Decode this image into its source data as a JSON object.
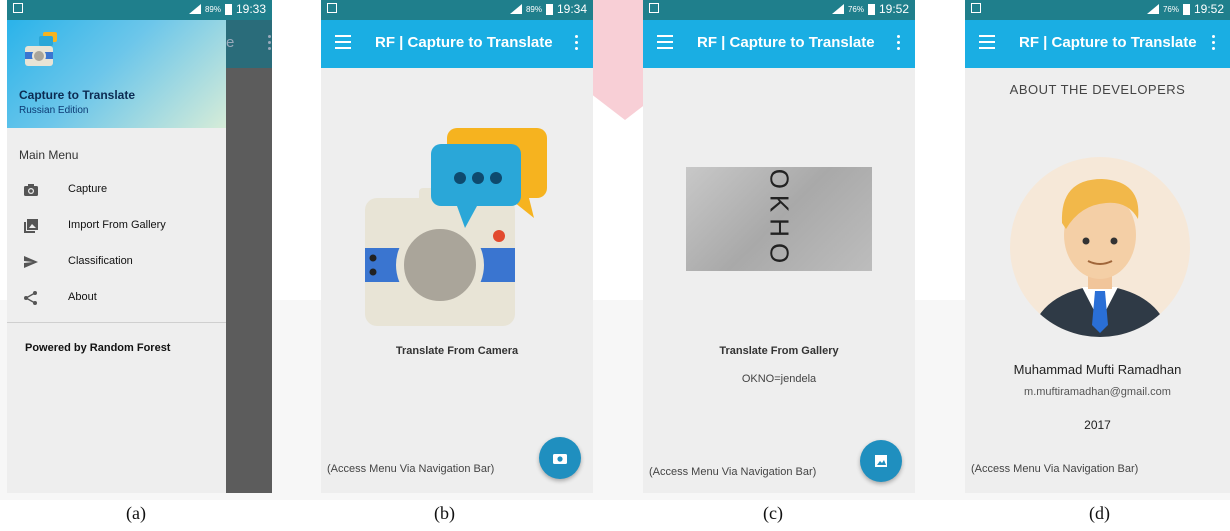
{
  "figure_labels": [
    "(a)",
    "(b)",
    "(c)",
    "(d)"
  ],
  "screen_a": {
    "status_battery": "89%",
    "status_time": "19:33",
    "behind_title_fragment": "e",
    "drawer_title": "Capture to Translate",
    "drawer_subtitle": "Russian Edition",
    "menu_header": "Main Menu",
    "menu_items": [
      {
        "label": "Capture",
        "icon": "camera-icon"
      },
      {
        "label": "Import From Gallery",
        "icon": "gallery-icon"
      },
      {
        "label": "Classification",
        "icon": "send-icon"
      },
      {
        "label": "About",
        "icon": "share-icon"
      }
    ],
    "footer_text": "Powered by Random Forest"
  },
  "screen_b": {
    "status_battery": "89%",
    "status_time": "19:34",
    "app_title": "RF | Capture to Translate",
    "caption": "Translate From Camera",
    "hint": "(Access Menu Via Navigation Bar)"
  },
  "screen_c": {
    "status_battery": "76%",
    "status_time": "19:52",
    "app_title": "RF | Capture to Translate",
    "captured_word": "OKHO",
    "caption": "Translate From Gallery",
    "result": "OKNO=jendela",
    "hint": "(Access Menu Via Navigation Bar)"
  },
  "screen_d": {
    "status_battery": "76%",
    "status_time": "19:52",
    "app_title": "RF | Capture to Translate",
    "section_title": "ABOUT THE DEVELOPERS",
    "developer_name": "Muhammad Mufti Ramadhan",
    "developer_email": "m.muftiramadhan@gmail.com",
    "year": "2017",
    "hint": "(Access Menu Via Navigation Bar)"
  },
  "colors": {
    "status_bar": "#1f7f8c",
    "app_bar": "#1aaee3",
    "fab": "#1f8fbf",
    "screen_bg": "#eeeeee"
  }
}
